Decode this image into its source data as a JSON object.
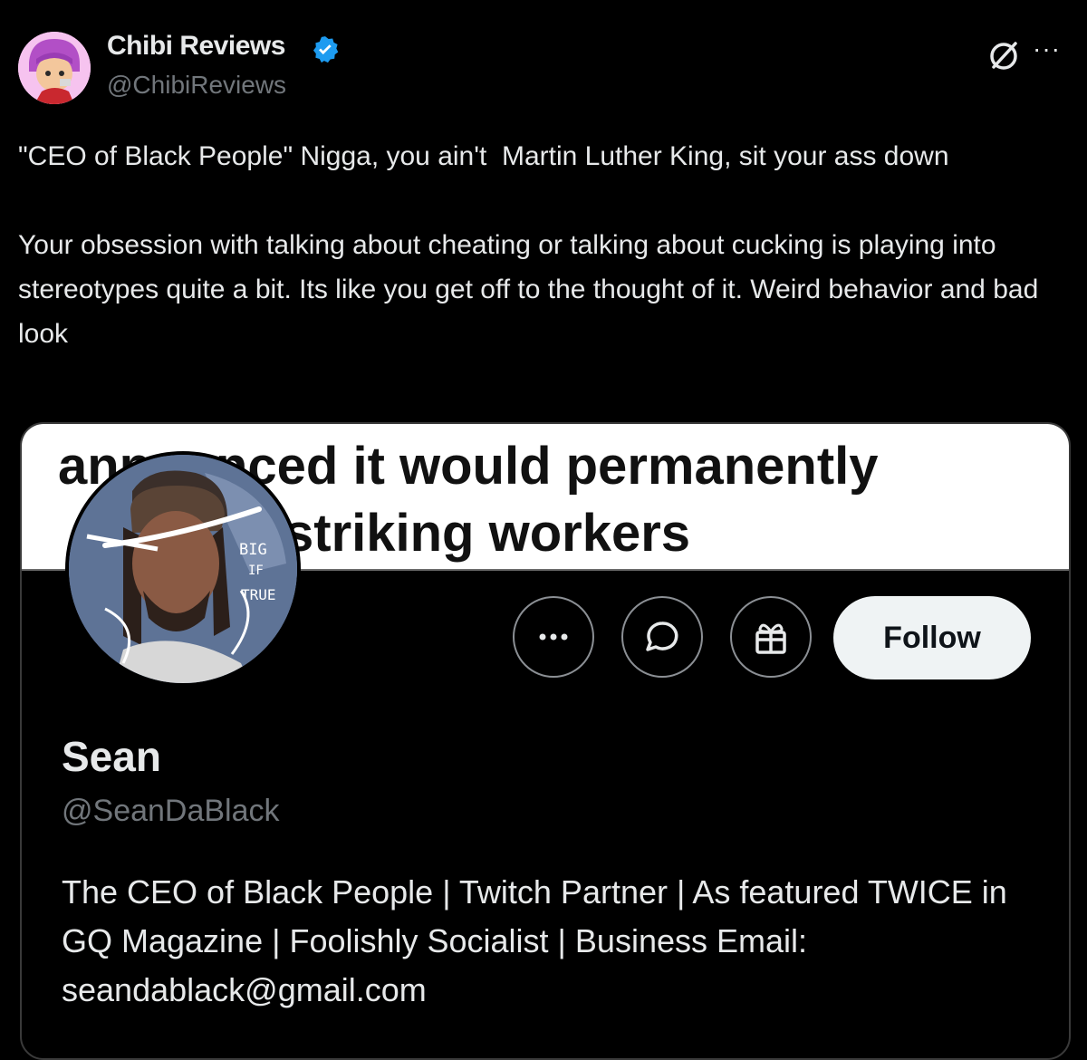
{
  "author": {
    "name": "Chibi Reviews",
    "handle": "@ChibiReviews",
    "verified": true,
    "avatar_icon": "chibi-avatar"
  },
  "icons": {
    "grok": "grok-icon",
    "more": "more-icon"
  },
  "tweet": {
    "text": "\"CEO of Black People\" Nigga, you ain't  Martin Luther King, sit your ass down\n\nYour obsession with talking about cheating or talking about cucking is playing into stereotypes quite a bit. Its like you get off to the thought of it. Weird behavior and bad look"
  },
  "media": {
    "headline_line1": "announced it would permanently",
    "headline_line2": "striking workers",
    "profile_pic_text_1": "BIG",
    "profile_pic_text_2": "IF",
    "profile_pic_text_3": "TRUE",
    "buttons": {
      "more_icon": "more-horizontal-icon",
      "message_icon": "message-bubble-icon",
      "gift_icon": "gift-icon",
      "follow_label": "Follow"
    },
    "profile": {
      "name": "Sean",
      "handle": "@SeanDaBlack",
      "bio": "The CEO of Black People | Twitch Partner | As featured TWICE in GQ Magazine | Foolishly Socialist | Business Email: seandablack@gmail.com"
    }
  },
  "colors": {
    "background": "#000000",
    "text": "#e7e9ea",
    "muted": "#71767b",
    "verified": "#1d9bf0",
    "follow_bg": "#eff3f4"
  }
}
